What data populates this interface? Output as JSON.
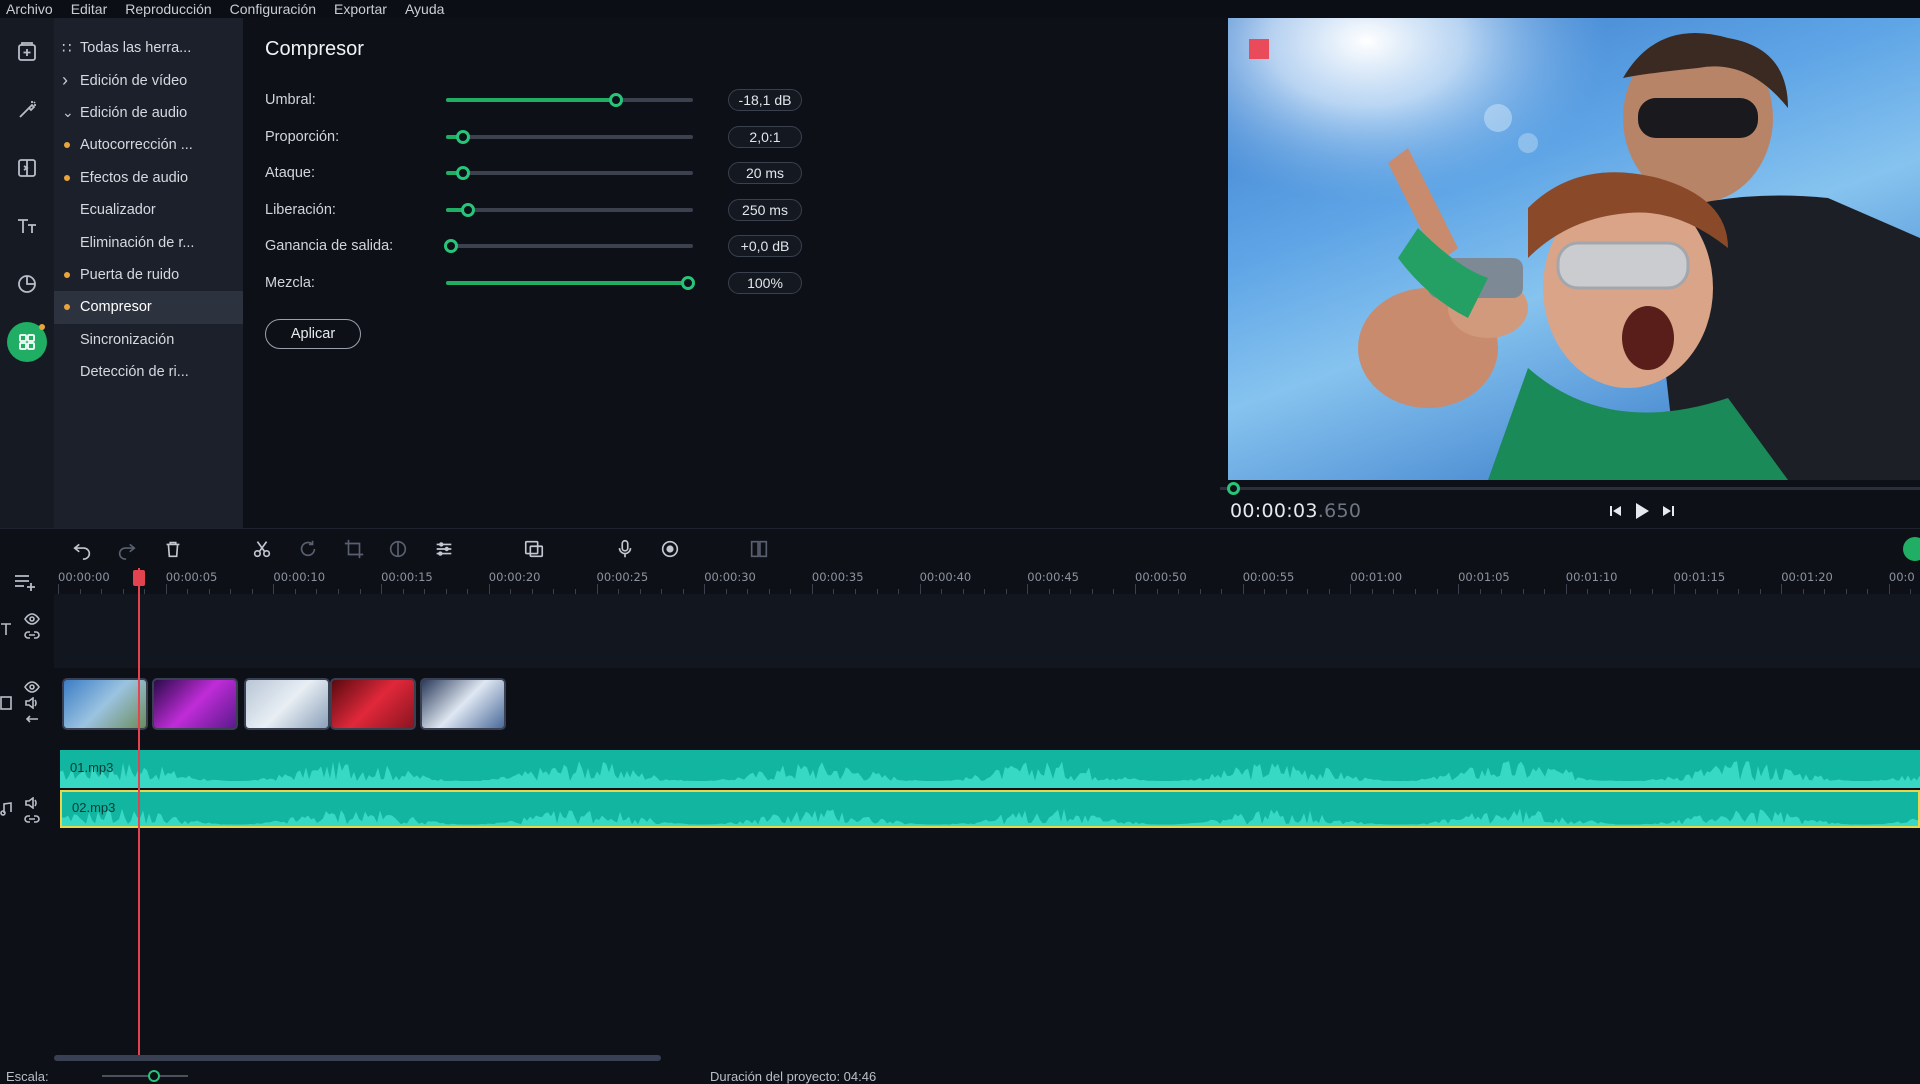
{
  "menu": [
    "Archivo",
    "Editar",
    "Reproducción",
    "Configuración",
    "Exportar",
    "Ayuda"
  ],
  "rail": {
    "icons": [
      "import-icon",
      "magic-wand-icon",
      "transitions-icon",
      "text-icon",
      "stickers-icon",
      "more-tools-icon"
    ],
    "active": "more-tools-icon",
    "accent": "#1fae63"
  },
  "tools": [
    {
      "label": "Todas las herra...",
      "prefix": "grid"
    },
    {
      "label": "Edición de vídeo",
      "prefix": "chevron-right"
    },
    {
      "label": "Edición de audio",
      "prefix": "chevron-down"
    },
    {
      "label": "Autocorrección ...",
      "prefix": "dot"
    },
    {
      "label": "Efectos de audio",
      "prefix": "dot"
    },
    {
      "label": "Ecualizador",
      "prefix": ""
    },
    {
      "label": "Eliminación de r...",
      "prefix": ""
    },
    {
      "label": "Puerta de ruido",
      "prefix": "dot"
    },
    {
      "label": "Compresor",
      "prefix": "dot",
      "selected": true
    },
    {
      "label": "Sincronización",
      "prefix": ""
    },
    {
      "label": "Detección de ri...",
      "prefix": ""
    }
  ],
  "compressor": {
    "title": "Compresor",
    "params": [
      {
        "label": "Umbral:",
        "value": "-18,1 dB",
        "level": 0.69
      },
      {
        "label": "Proporción:",
        "value": "2,0:1",
        "level": 0.07
      },
      {
        "label": "Ataque:",
        "value": "20 ms",
        "level": 0.07
      },
      {
        "label": "Liberación:",
        "value": "250 ms",
        "level": 0.09
      },
      {
        "label": "Ganancia de salida:",
        "value": "+0,0 dB",
        "level": 0.02
      },
      {
        "label": "Mezcla:",
        "value": "100%",
        "level": 0.98
      }
    ],
    "apply_label": "Aplicar"
  },
  "preview": {
    "timecode_main": "00:00:03",
    "timecode_ms": ".650",
    "progress": 0.01
  },
  "toolbar": [
    "undo-icon",
    "redo-icon",
    "delete-icon",
    "cut-icon",
    "rotate-icon",
    "crop-icon",
    "color-icon",
    "adjust-icon",
    "overlay-icon",
    "microphone-icon",
    "record-icon",
    "split-view-icon"
  ],
  "ruler": [
    "00:00:00",
    "00:00:05",
    "00:00:10",
    "00:00:15",
    "00:00:20",
    "00:00:25",
    "00:00:30",
    "00:00:35",
    "00:00:40",
    "00:00:45",
    "00:00:50",
    "00:00:55",
    "00:01:00",
    "00:01:05",
    "00:01:10",
    "00:01:15",
    "00:01:20",
    "00:0"
  ],
  "clips": [
    {
      "name": "clip-skydive",
      "colors": [
        "#3c7dc6",
        "#9bc3e0",
        "#6a8c5a"
      ]
    },
    {
      "name": "clip-concert",
      "colors": [
        "#2a0b4a",
        "#c02cd8",
        "#5a1a8c"
      ]
    },
    {
      "name": "clip-water",
      "colors": [
        "#b8c6d6",
        "#e8eef4",
        "#8aa0b8"
      ]
    },
    {
      "name": "clip-red",
      "colors": [
        "#5a0a10",
        "#e0283a",
        "#8a1420"
      ]
    },
    {
      "name": "clip-snow",
      "colors": [
        "#2a3a5a",
        "#dfe7f2",
        "#4a6a9a"
      ]
    }
  ],
  "audio": [
    {
      "label": "01.mp3"
    },
    {
      "label": "02.mp3"
    }
  ],
  "status": {
    "scale_label": "Escala:",
    "duration_label": "Duración del proyecto:  04:46"
  }
}
